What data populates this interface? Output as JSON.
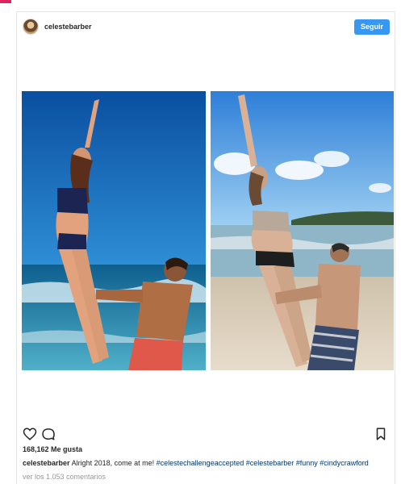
{
  "post": {
    "username": "celestebarber",
    "follow_label": "Seguir",
    "likes_text": "168,162 Me gusta",
    "caption_user": "celestebarber",
    "caption_text": "Alright 2018, come at me!",
    "caption_hashtags": "#celestechallengeaccepted #celestebarber #funny #cindycrawford",
    "view_comments": "ver los 1.053 comentarios"
  },
  "icons": {
    "like": "heart-icon",
    "comment": "comment-icon",
    "save": "bookmark-icon"
  },
  "colors": {
    "follow_button": "#3897f0",
    "hashtag": "#003569",
    "muted_text": "#999999"
  }
}
